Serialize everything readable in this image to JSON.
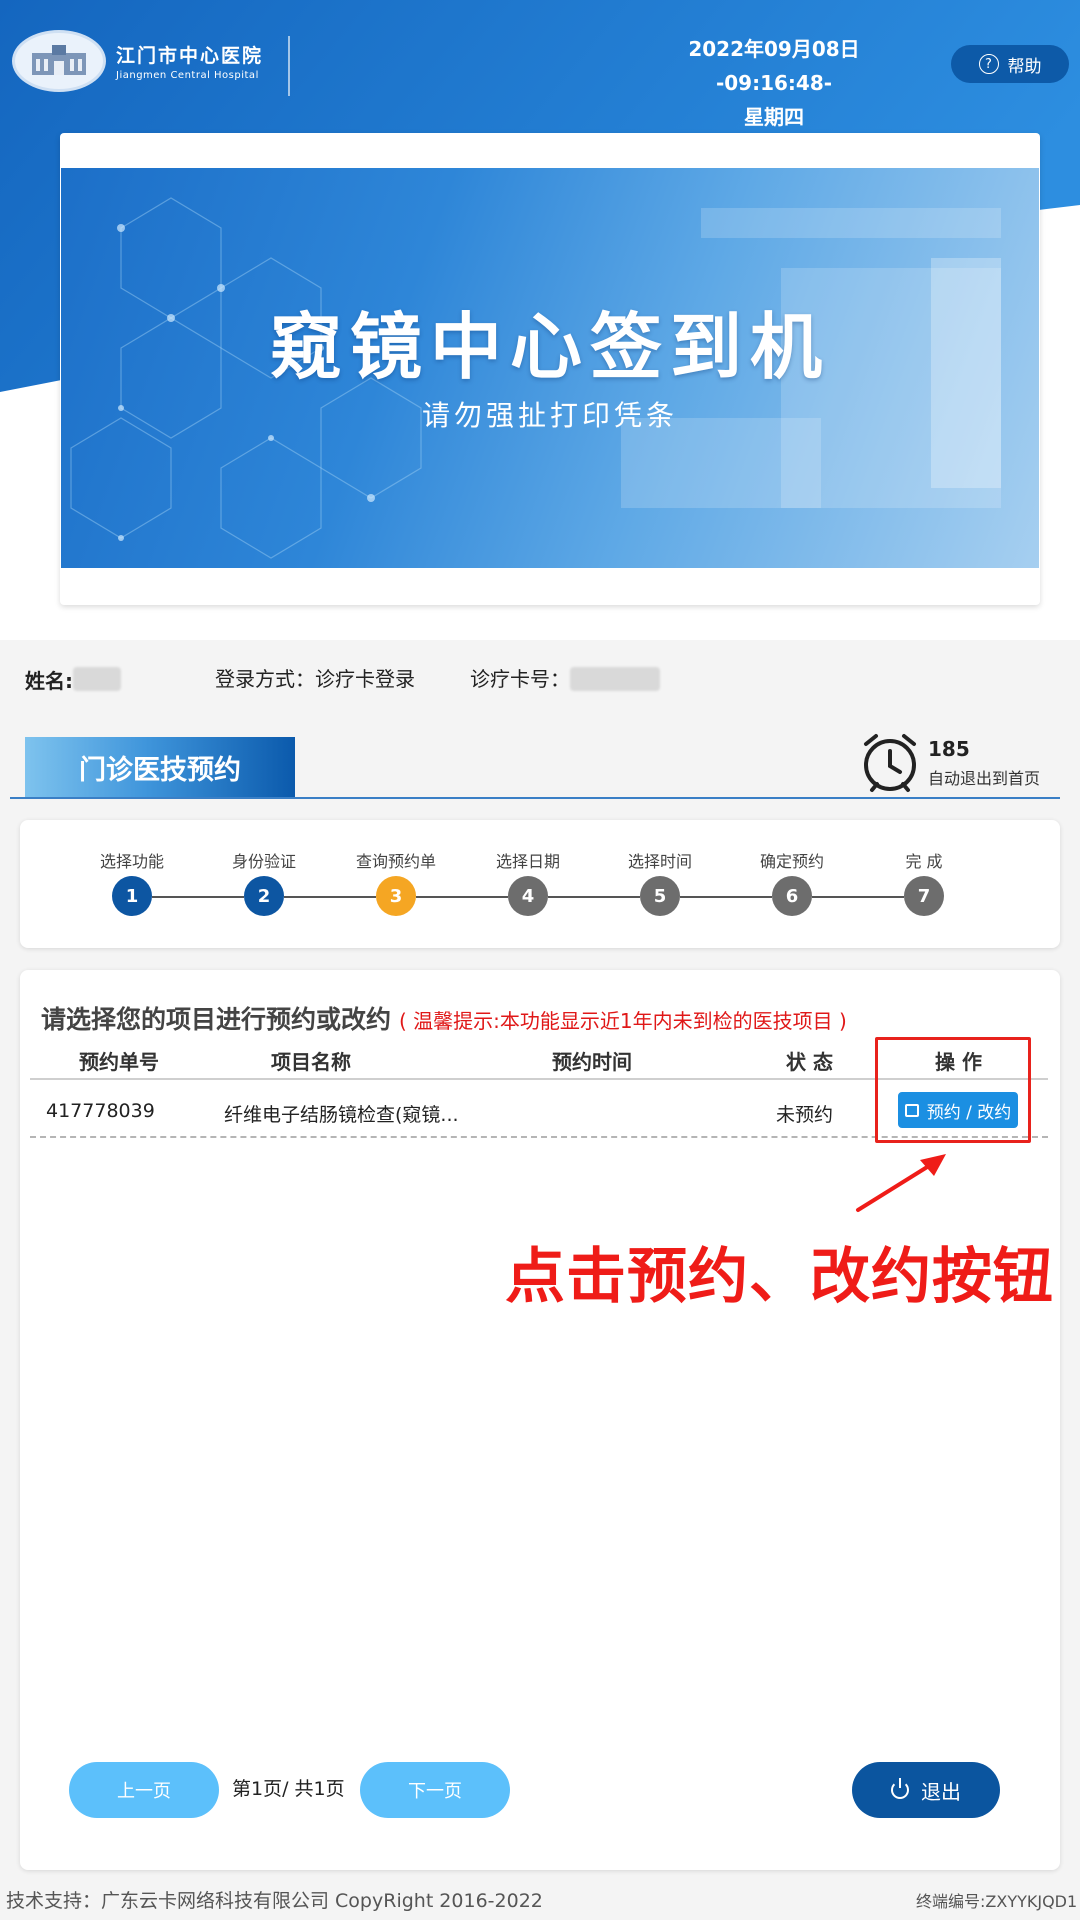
{
  "header": {
    "hospital_name_cn": "江门市中心医院",
    "hospital_name_en": "Jiangmen Central Hospital",
    "datetime_line1": "2022年09月08日 -09:16:48-",
    "datetime_line2": "星期四",
    "help_label": "帮助",
    "help_icon_glyph": "?"
  },
  "banner": {
    "title": "窥镜中心签到机",
    "subtitle": "请勿强扯打印凭条"
  },
  "patient": {
    "name_label": "姓名:",
    "login_label": "登录方式：诊疗卡登录",
    "card_label": "诊疗卡号："
  },
  "section": {
    "title": "门诊医技预约",
    "countdown": "185",
    "countdown_label": "自动退出到首页"
  },
  "steps": [
    {
      "label": "选择功能",
      "num": "1",
      "state": "done"
    },
    {
      "label": "身份验证",
      "num": "2",
      "state": "done"
    },
    {
      "label": "查询预约单",
      "num": "3",
      "state": "current"
    },
    {
      "label": "选择日期",
      "num": "4",
      "state": "todo"
    },
    {
      "label": "选择时间",
      "num": "5",
      "state": "todo"
    },
    {
      "label": "确定预约",
      "num": "6",
      "state": "todo"
    },
    {
      "label": "完  成",
      "num": "7",
      "state": "todo"
    }
  ],
  "list": {
    "heading": "请选择您的项目进行预约或改约",
    "tip": "( 温馨提示:本功能显示近1年内未到检的医技项目 )",
    "columns": [
      "预约单号",
      "项目名称",
      "预约时间",
      "状 态",
      "操 作"
    ],
    "rows": [
      {
        "order_no": "417778039",
        "item": "纤维电子结肠镜检查(窥镜...",
        "time": "",
        "status": "未预约",
        "action": "预约 / 改约"
      }
    ],
    "annotation": "点击预约、改约按钮"
  },
  "pager": {
    "prev": "上一页",
    "info": "第1页/  共1页",
    "next": "下一页",
    "exit": "退出"
  },
  "footer": {
    "support": "技术支持：广东云卡网络科技有限公司 CopyRight 2016-2022",
    "terminal": "终端编号:ZXYYKJQD1"
  },
  "colors": {
    "brand_blue": "#0b559f",
    "step_current": "#f5a623",
    "step_done": "#0d56a2",
    "step_todo": "#6d6d6d",
    "annotation_red": "#ef1c18",
    "pill_blue": "#5cc0fb"
  }
}
